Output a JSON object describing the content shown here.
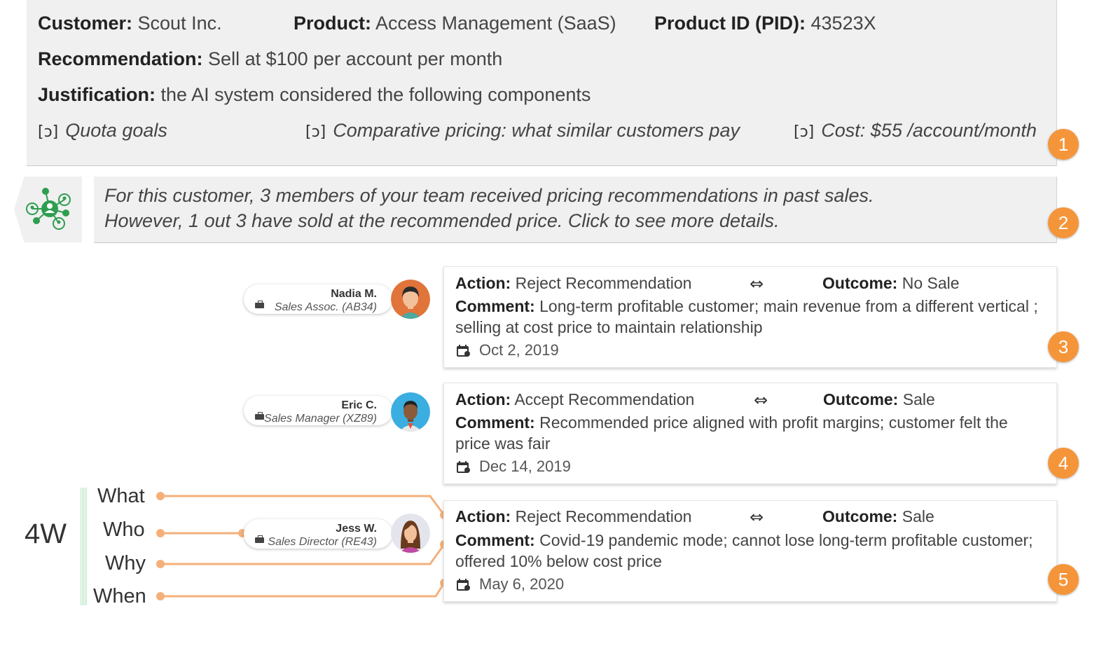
{
  "header": {
    "customer_label": "Customer:",
    "customer_value": "Scout Inc.",
    "product_label": "Product:",
    "product_value": "Access Management (SaaS)",
    "pid_label": "Product ID (PID):",
    "pid_value": "43523X",
    "recommendation_label": "Recommendation:",
    "recommendation_value": "Sell at $100 per account per month",
    "justification_label": "Justification:",
    "justification_value": "the AI system considered the following components",
    "components": [
      {
        "icon": "[ᴐ]",
        "label": "Quota goals"
      },
      {
        "icon": "[ᴐ]",
        "label": "Comparative pricing: what similar customers pay"
      },
      {
        "icon": "[ᴐ]",
        "label": "Cost: $55 /account/month"
      }
    ]
  },
  "insight": {
    "line1": "For this customer, 3 members of your team received pricing recommendations in past sales.",
    "line2": "However, 1 out 3 have sold at the recommended price. Click to see more details.",
    "icon": "team-network-icon"
  },
  "badges": [
    "1",
    "2",
    "3",
    "4",
    "5"
  ],
  "labels": {
    "action": "Action:",
    "outcome": "Outcome:",
    "comment": "Comment:",
    "arrow": "⇔"
  },
  "records": [
    {
      "name": "Nadia M.",
      "role": "Sales Assoc.  (AB34)",
      "action": "Reject Recommendation",
      "outcome": "No Sale",
      "comment": "Long-term profitable customer; main revenue from a different vertical ; selling at cost price to maintain relationship",
      "date": "Oct 2, 2019"
    },
    {
      "name": "Eric C.",
      "role": "Sales Manager (XZ89)",
      "action": "Accept Recommendation",
      "outcome": "Sale",
      "comment": "Recommended price aligned with profit margins; customer felt the price was fair",
      "date": "Dec 14, 2019"
    },
    {
      "name": "Jess W.",
      "role": "Sales Director (RE43)",
      "action": "Reject Recommendation",
      "outcome": "Sale",
      "comment": "Covid-19 pandemic mode; cannot lose long-term profitable customer; offered 10% below cost price",
      "date": "May 6, 2020"
    }
  ],
  "fourw": {
    "title": "4W",
    "items": [
      "What",
      "Who",
      "Why",
      "When"
    ]
  },
  "colors": {
    "accent": "#f5953a",
    "panel": "#f0f0f0",
    "icon_green": "#2e9e4f"
  }
}
